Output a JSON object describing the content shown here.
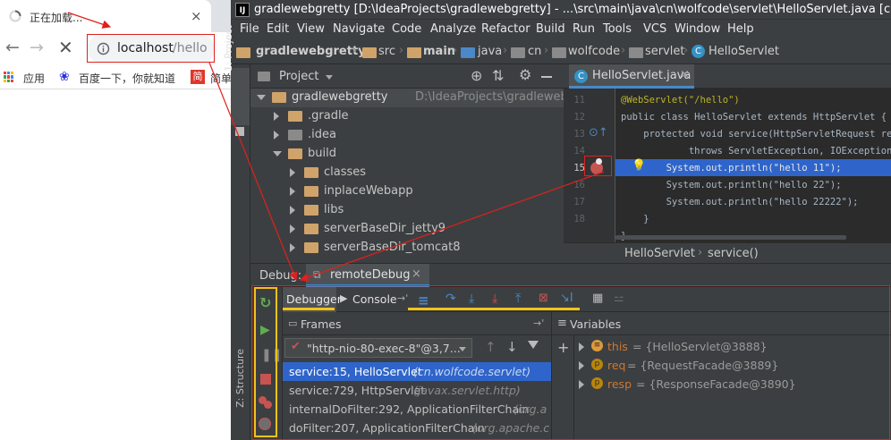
{
  "browser": {
    "tab_title": "正在加载...",
    "url_host": "localhost",
    "url_path": "/hello",
    "bookmarks": [
      "应用",
      "百度一下，你就知道",
      "简"
    ],
    "bookmark_partial": "简单"
  },
  "ide": {
    "title": "gradlewebgretty [D:\\IdeaProjects\\gradlewebgretty] - ...\\src\\main\\java\\cn\\wolfcode\\servlet\\HelloServlet.java [cn.wolfcode.gr",
    "menu": [
      "File",
      "Edit",
      "View",
      "Navigate",
      "Code",
      "Analyze",
      "Refactor",
      "Build",
      "Run",
      "Tools",
      "VCS",
      "Window",
      "Help"
    ],
    "nav": [
      "gradlewebgretty",
      "src",
      "main",
      "java",
      "cn",
      "wolfcode",
      "servlet",
      "HelloServlet"
    ],
    "side_tab": "1: Project",
    "structure_tab": "Z: Structure",
    "project": {
      "header": "Project",
      "root": "gradlewebgretty",
      "root_path": "D:\\IdeaProjects\\gradlewebgretty",
      "items": [
        ".gradle",
        ".idea",
        "build",
        "classes",
        "inplaceWebapp",
        "libs",
        "serverBaseDir_jetty9",
        "serverBaseDir_tomcat8"
      ]
    },
    "editor": {
      "tab": "HelloServlet.java",
      "line_numbers": [
        "11",
        "12",
        "13",
        "14",
        "15",
        "16",
        "17",
        "18"
      ],
      "lines": [
        "@WebServlet(\"/hello\")",
        "public class HelloServlet extends HttpServlet {",
        "    protected void service(HttpServletRequest req,",
        "            throws ServletException, IOException {",
        "        System.out.println(\"hello 11\");",
        "        System.out.println(\"hello 22\");",
        "        System.out.println(\"hello 22222\");",
        "    }",
        "}"
      ],
      "breadcrumb": [
        "HelloServlet",
        "service()"
      ]
    },
    "debug": {
      "tabs": [
        "Debug:",
        "remoteDebug"
      ],
      "debugger_tab": "Debugger",
      "console_tab": "Console",
      "frames_label": "Frames",
      "variables_label": "Variables",
      "thread": "\"http-nio-80-exec-8\"@3,7...",
      "frames": [
        {
          "method": "service:15, HelloServlet",
          "pkg": "(cn.wolfcode.servlet)"
        },
        {
          "method": "service:729, HttpServlet",
          "pkg": "(javax.servlet.http)"
        },
        {
          "method": "internalDoFilter:292, ApplicationFilterChain",
          "pkg": "(org.a"
        },
        {
          "method": "doFilter:207, ApplicationFilterChain",
          "pkg": "(org.apache.c"
        }
      ],
      "variables": [
        {
          "name": "this",
          "value": "= {HelloServlet@3888}"
        },
        {
          "name": "req",
          "value": "= {RequestFacade@3889}"
        },
        {
          "name": "resp",
          "value": "= {ResponseFacade@3890}"
        }
      ]
    }
  },
  "colors": {
    "annotation_red": "#e0201c",
    "annotation_yellow": "#f2c318",
    "ide_bg": "#3c3f41",
    "editor_bg": "#2b2b2b",
    "selection": "#2f65ca"
  }
}
